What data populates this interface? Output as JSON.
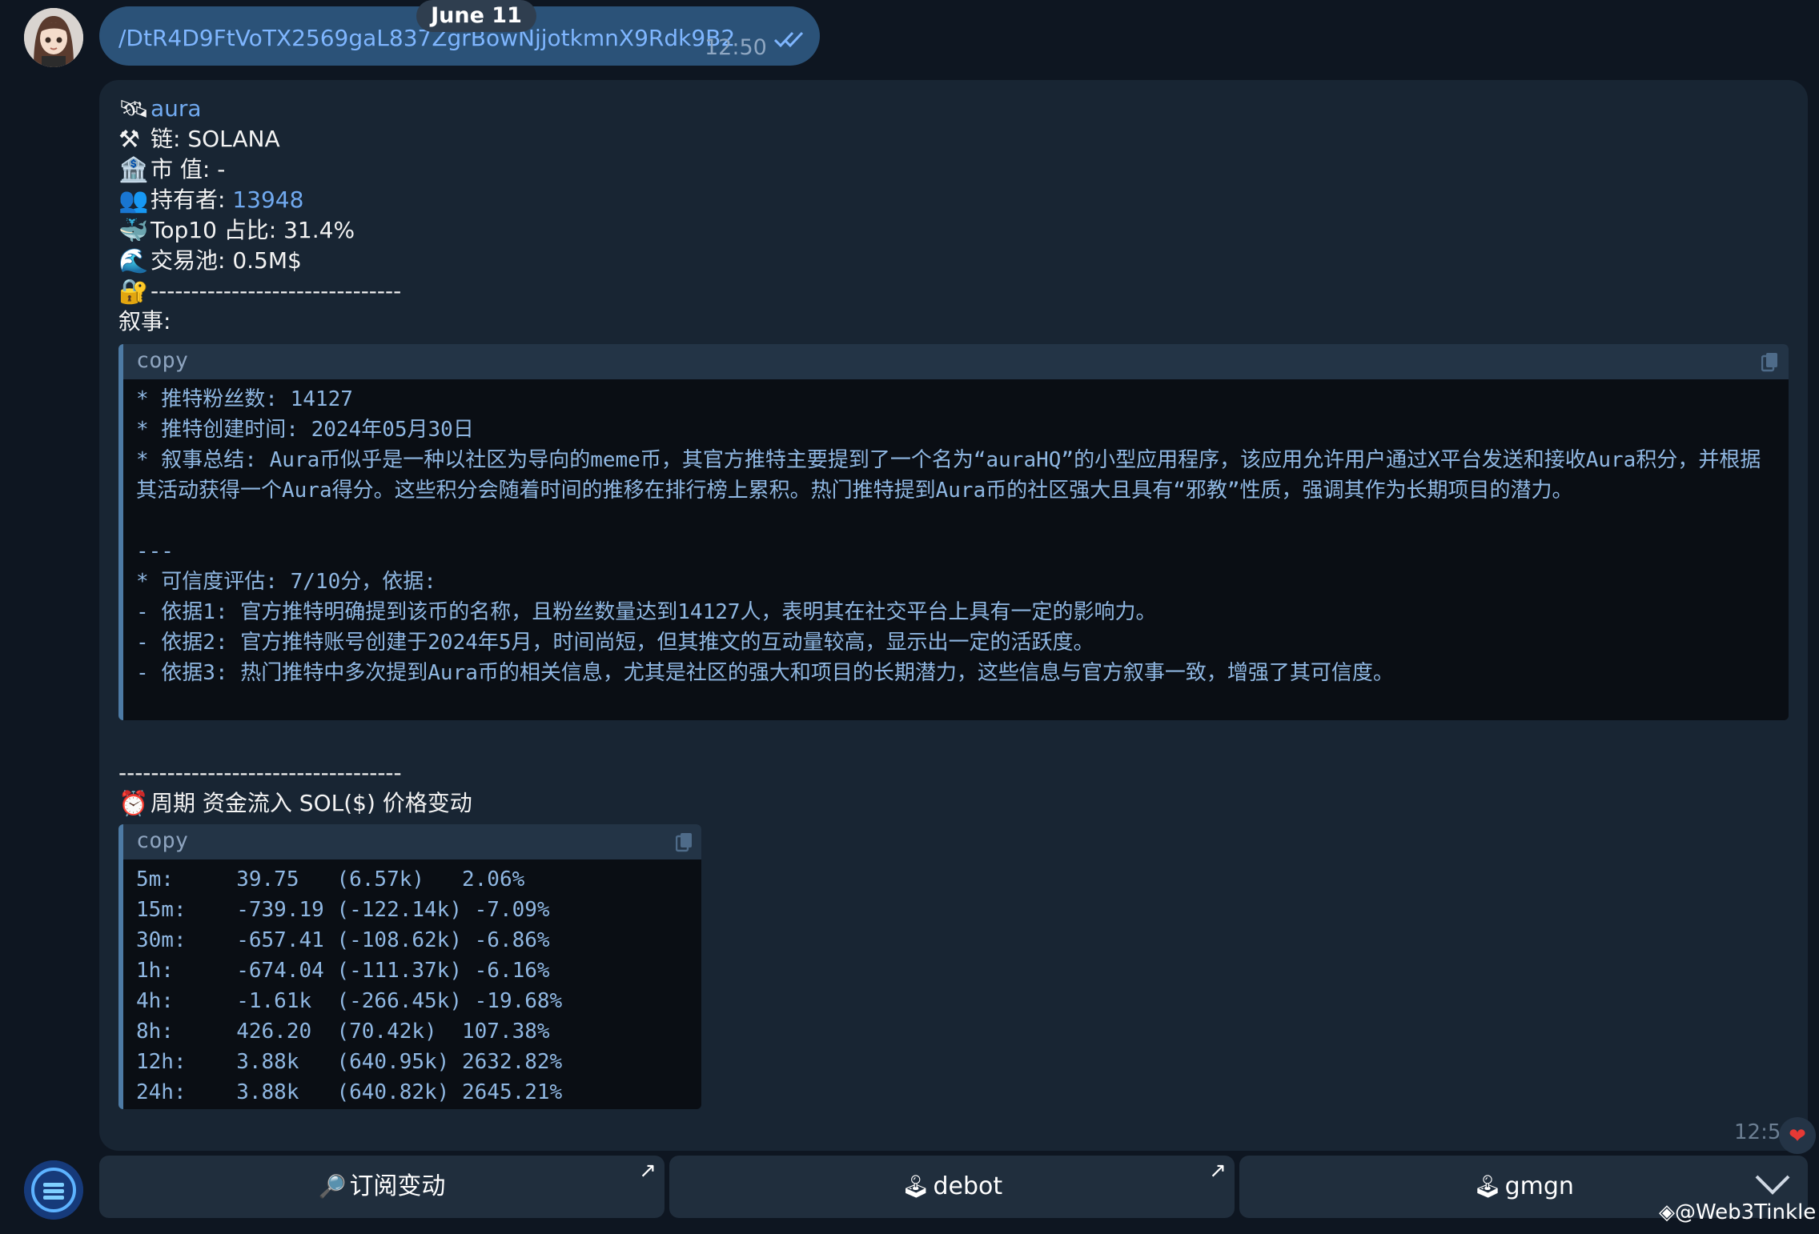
{
  "chat": {
    "date_label": "June 11",
    "outgoing": {
      "text": "/DtR4D9FtVoTX2569gaL837ZgrBowNjjotkmnX9Rdk9B2",
      "time": "12:50",
      "status_icon": "double-check-icon"
    },
    "message": {
      "token_name": "aura",
      "chain_label": "链: SOLANA",
      "market_cap_label": "市 值:  -",
      "holders_label": "持有者: ",
      "holders_value": "13948",
      "top10_label": "Top10 占比:  31.4%",
      "pool_label": "交易池: 0.5M$",
      "divider1": "-------------------------------",
      "narrative_label": "叙事:",
      "code1": {
        "label": "copy",
        "lines": [
          "* 推特粉丝数: 14127",
          "* 推特创建时间: 2024年05月30日",
          "* 叙事总结: Aura币似乎是一种以社区为导向的meme币，其官方推特主要提到了一个名为“auraHQ”的小型应用程序，该应用允许用户通过X平台发送和接收Aura积分，并根据其活动获得一个Aura得分。这些积分会随着时间的推移在排行榜上累积。热门推特提到Aura币的社区强大且具有“邪教”性质，强调其作为长期项目的潜力。",
          " ",
          "---",
          "* 可信度评估: 7/10分，依据:",
          "- 依据1: 官方推特明确提到该币的名称，且粉丝数量达到14127人，表明其在社交平台上具有一定的影响力。",
          "- 依据2: 官方推特账号创建于2024年5月，时间尚短，但其推文的互动量较高，显示出一定的活跃度。",
          "- 依据3: 热门推特中多次提到Aura币的相关信息，尤其是社区的强大和项目的长期潜力，这些信息与官方叙事一致，增强了其可信度。"
        ]
      },
      "divider2": "-----------------------------------",
      "flow_header": "周期   资金流入 SOL($) 价格变动",
      "code2": {
        "label": "copy",
        "rows": [
          "5m:     39.75   (6.57k)   2.06%",
          "15m:    -739.19 (-122.14k) -7.09%",
          "30m:    -657.41 (-108.62k) -6.86%",
          "1h:     -674.04 (-111.37k) -6.16%",
          "4h:     -1.61k  (-266.45k) -19.68%",
          "8h:     426.20  (70.42k)  107.38%",
          "12h:    3.88k   (640.95k) 2632.82%",
          "24h:    3.88k   (640.82k) 2645.21%"
        ]
      },
      "time": "12:5",
      "reaction": "❤"
    },
    "keyboard": [
      {
        "label": "订阅变动",
        "icon": "magnifier-icon",
        "glyph": "🔎",
        "arrow": "↗"
      },
      {
        "label": "debot",
        "icon": "joystick-icon",
        "glyph": "🕹",
        "arrow": "↗"
      },
      {
        "label": "gmgn",
        "icon": "joystick-icon",
        "glyph": "🕹",
        "arrow": ""
      }
    ],
    "watermark": "◈@Web3Tinkle"
  },
  "colors": {
    "background": "#0e1621",
    "bubble_out": "#2b5278",
    "bubble_in": "#182533",
    "link": "#71aaf0",
    "code_text": "#8fb7e2",
    "code_header": "#233446"
  }
}
